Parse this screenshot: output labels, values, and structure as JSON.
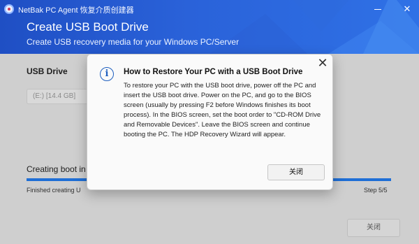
{
  "window": {
    "app_name": "NetBak PC Agent 恢复介质创建器",
    "minimize_glyph": "",
    "close_glyph": "✕"
  },
  "header": {
    "title": "Create USB Boot Drive",
    "subtitle": "Create USB recovery media for your Windows PC/Server"
  },
  "main": {
    "usb_drive_label": "USB Drive",
    "drive_value": "(E:) [14.4 GB]",
    "creating_label": "Creating boot in",
    "finished_label": "Finished creating U",
    "step_label": "Step 5/5",
    "progress_percent": 100,
    "close_button_label": "关闭"
  },
  "dialog": {
    "title": "How to Restore Your PC with a USB Boot Drive",
    "body": "To restore your PC with the USB boot drive, power off the PC and insert the USB boot drive. Power on the PC, and go to the BIOS screen (usually by pressing F2 before Windows finishes its boot process). In the BIOS screen, set the boot order to \"CD-ROM Drive and Removable Devices\". Leave the BIOS screen and continue booting the PC. The HDP Recovery Wizard will appear.",
    "ok_label": "关闭",
    "close_glyph": "✕",
    "info_glyph": "i"
  },
  "colors": {
    "header_blue": "#2a62d9",
    "progress_blue": "#1f6fd6",
    "overlay_gray": "#cfcfcf"
  }
}
